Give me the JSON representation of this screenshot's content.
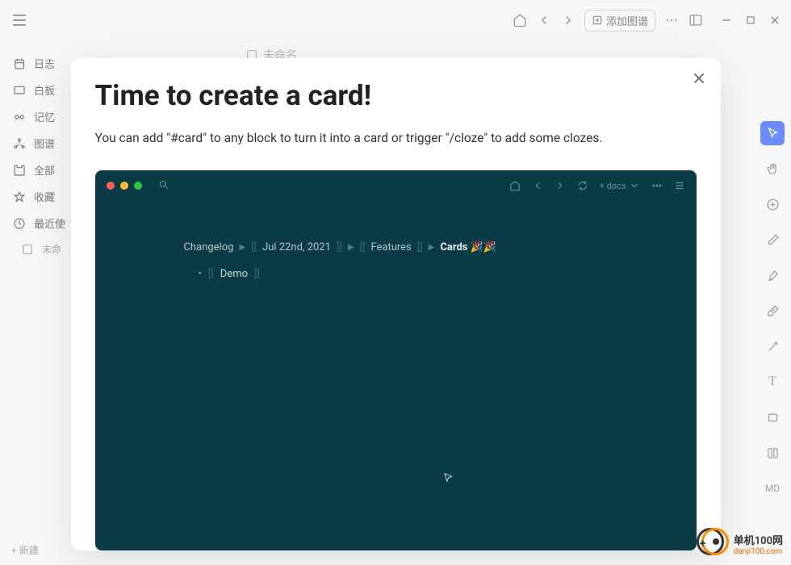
{
  "topbar": {
    "add_graph_label": "添加图谱"
  },
  "sidebar": {
    "items": [
      {
        "label": "日志"
      },
      {
        "label": "白板"
      },
      {
        "label": "记忆"
      },
      {
        "label": "图谱"
      },
      {
        "label": "全部"
      },
      {
        "label": "收藏"
      },
      {
        "label": "最近使"
      }
    ],
    "sub_item": "未命",
    "new_label": "+ 新建"
  },
  "tab": {
    "placeholder": "未命名"
  },
  "right_toolbar": {
    "md_label": "MD",
    "text_label": "T"
  },
  "modal": {
    "title": "Time to create a card!",
    "description": "You can add \"#card\" to any block to turn it into a card or trigger \"/cloze\" to add some clozes."
  },
  "demo": {
    "docs_label": "+ docs",
    "breadcrumb": {
      "items": [
        "Changelog",
        "Jul 22nd, 2021",
        "Features",
        "Cards 🎉🎉"
      ]
    },
    "bullet_text": "Demo"
  },
  "watermark": {
    "name": "单机100网",
    "url": "danji100.com"
  }
}
